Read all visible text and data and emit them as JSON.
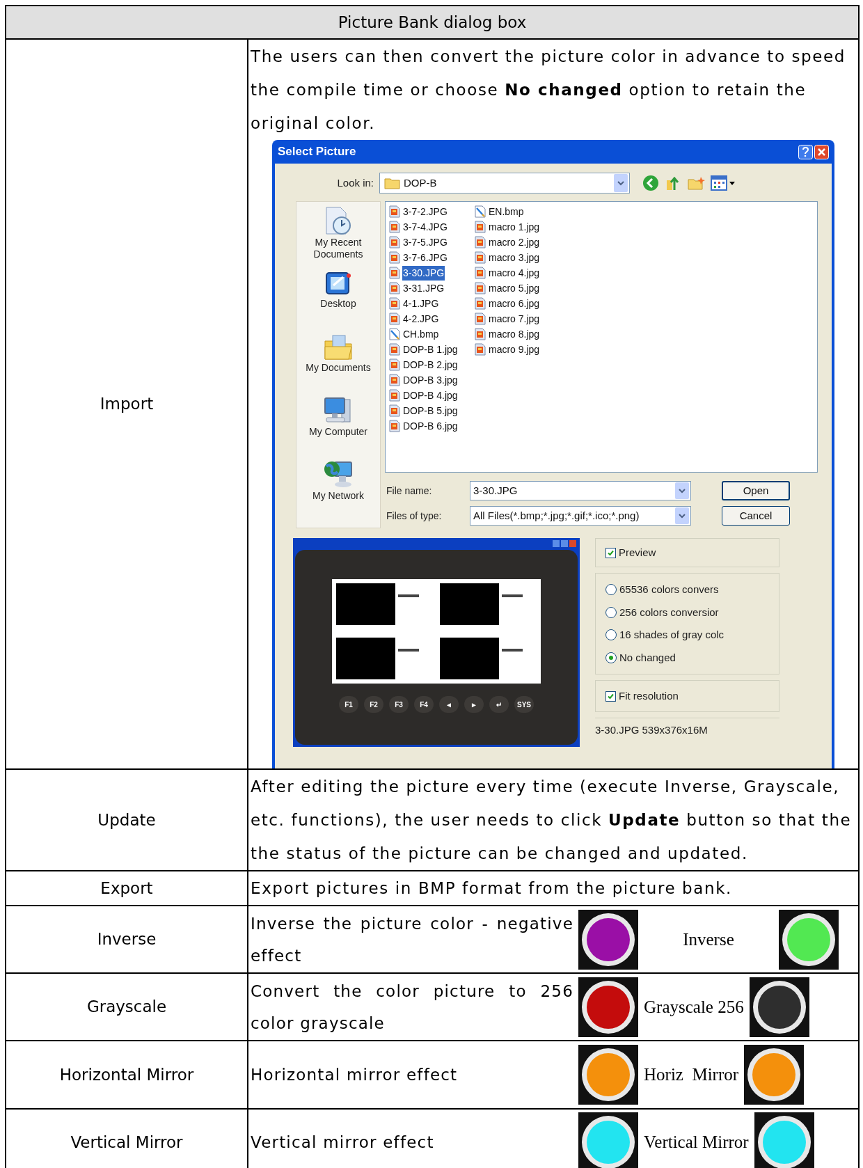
{
  "table": {
    "title": "Picture Bank dialog box",
    "rows": [
      {
        "kind": "dialog",
        "label": "Import",
        "text": "The users can then convert the picture color in advance to speed the compile time or choose **No changed** option to retain the original color."
      },
      {
        "kind": "text",
        "label": "Update",
        "text": "After editing the picture every time (execute Inverse, Grayscale, etc. functions), the user needs to click **Update** button so that the the status of the picture can be changed and updated."
      },
      {
        "kind": "text",
        "label": "Export",
        "text": "Export pictures in BMP format from the picture bank."
      },
      {
        "kind": "example",
        "label": "Inverse",
        "text": "Inverse the picture color - negative effect",
        "caption": "Inverse",
        "images": [
          {
            "color": "#9a0fa6"
          },
          {
            "color": "#52e852"
          }
        ]
      },
      {
        "kind": "example",
        "label": "Grayscale",
        "text": "Convert the color picture to 256 color grayscale",
        "caption": "Grayscale 256",
        "images": [
          {
            "color": "#c40c0c"
          },
          {
            "color": "#2e2e2e"
          }
        ]
      },
      {
        "kind": "example",
        "label": "Horizontal Mirror",
        "text": "Horizontal mirror effect",
        "caption": "Horiz  Mirror",
        "images": [
          {
            "color": "#f4900c"
          },
          {
            "color": "#f4900c"
          }
        ]
      },
      {
        "kind": "example",
        "label": "Vertical Mirror",
        "text": "Vertical mirror effect",
        "caption": "Vertical Mirror",
        "images": [
          {
            "color": "#22e4f0"
          },
          {
            "color": "#22e4f0"
          }
        ]
      }
    ]
  },
  "dialog": {
    "title": "Select Picture",
    "look_in": {
      "label": "Look in:",
      "value": "DOP-B"
    },
    "places": [
      {
        "kind": "recent",
        "label": "My Recent Documents"
      },
      {
        "kind": "desktop",
        "label": "Desktop"
      },
      {
        "kind": "documents",
        "label": "My Documents"
      },
      {
        "kind": "computer",
        "label": "My Computer"
      },
      {
        "kind": "network",
        "label": "My Network"
      }
    ],
    "files": [
      {
        "name": "3-7-2.JPG",
        "kind": "jpg",
        "selected": false
      },
      {
        "name": "3-7-4.JPG",
        "kind": "jpg",
        "selected": false
      },
      {
        "name": "3-7-5.JPG",
        "kind": "jpg",
        "selected": false
      },
      {
        "name": "3-7-6.JPG",
        "kind": "jpg",
        "selected": false
      },
      {
        "name": "3-30.JPG",
        "kind": "jpg",
        "selected": true
      },
      {
        "name": "3-31.JPG",
        "kind": "jpg",
        "selected": false
      },
      {
        "name": "4-1.JPG",
        "kind": "jpg",
        "selected": false
      },
      {
        "name": "4-2.JPG",
        "kind": "jpg",
        "selected": false
      },
      {
        "name": "CH.bmp",
        "kind": "bmp",
        "selected": false
      },
      {
        "name": "DOP-B 1.jpg",
        "kind": "jpg",
        "selected": false
      },
      {
        "name": "DOP-B 2.jpg",
        "kind": "jpg",
        "selected": false
      },
      {
        "name": "DOP-B 3.jpg",
        "kind": "jpg",
        "selected": false
      },
      {
        "name": "DOP-B 4.jpg",
        "kind": "jpg",
        "selected": false
      },
      {
        "name": "DOP-B 5.jpg",
        "kind": "jpg",
        "selected": false
      },
      {
        "name": "DOP-B 6.jpg",
        "kind": "jpg",
        "selected": false
      },
      {
        "name": "EN.bmp",
        "kind": "bmp",
        "selected": false
      },
      {
        "name": "macro 1.jpg",
        "kind": "jpg",
        "selected": false
      },
      {
        "name": "macro 2.jpg",
        "kind": "jpg",
        "selected": false
      },
      {
        "name": "macro 3.jpg",
        "kind": "jpg",
        "selected": false
      },
      {
        "name": "macro 4.jpg",
        "kind": "jpg",
        "selected": false
      },
      {
        "name": "macro 5.jpg",
        "kind": "jpg",
        "selected": false
      },
      {
        "name": "macro 6.jpg",
        "kind": "jpg",
        "selected": false
      },
      {
        "name": "macro 7.jpg",
        "kind": "jpg",
        "selected": false
      },
      {
        "name": "macro 8.jpg",
        "kind": "jpg",
        "selected": false
      },
      {
        "name": "macro 9.jpg",
        "kind": "jpg",
        "selected": false
      }
    ],
    "file_name": {
      "label": "File name:",
      "value": "3-30.JPG"
    },
    "file_type": {
      "label": "Files of type:",
      "value": "All Files(*.bmp;*.jpg;*.gif;*.ico;*.png)"
    },
    "buttons": [
      "Open",
      "Cancel"
    ],
    "preview_keys": [
      "F1",
      "F2",
      "F3",
      "F4",
      "◄",
      "►",
      "↵",
      "SYS"
    ],
    "preview": {
      "label": "Preview",
      "checked": true
    },
    "conversion": [
      {
        "label": "65536 colors convers",
        "selected": false
      },
      {
        "label": "256 colors conversior",
        "selected": false
      },
      {
        "label": "16 shades of gray colc",
        "selected": false
      },
      {
        "label": "No changed",
        "selected": true
      }
    ],
    "fit": {
      "label": "Fit resolution",
      "checked": true
    },
    "status": "3-30.JPG 539x376x16M"
  }
}
